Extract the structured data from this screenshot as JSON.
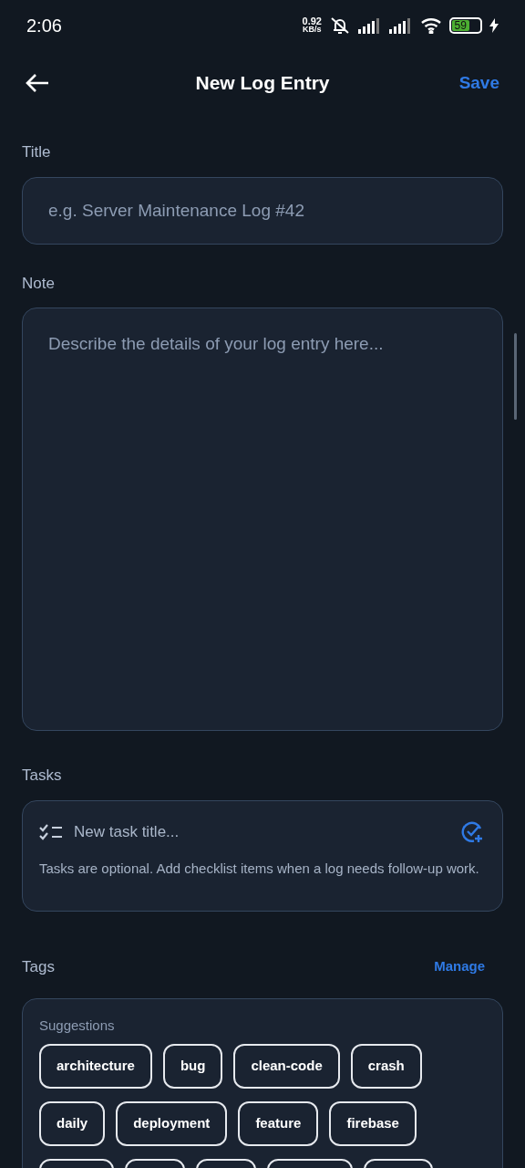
{
  "status_bar": {
    "time": "2:06",
    "speed_value": "0.92",
    "speed_unit": "KB/s",
    "battery": "59"
  },
  "header": {
    "title": "New Log Entry",
    "save": "Save"
  },
  "title_field": {
    "label": "Title",
    "placeholder": "e.g. Server Maintenance Log #42"
  },
  "note_field": {
    "label": "Note",
    "placeholder": "Describe the details of your log entry here..."
  },
  "tasks": {
    "label": "Tasks",
    "placeholder": "New task title...",
    "hint": "Tasks are optional. Add checklist items when a log needs follow-up work."
  },
  "tags": {
    "label": "Tags",
    "manage": "Manage",
    "suggestions_label": "Suggestions",
    "suggestions": [
      {
        "label": "architecture"
      },
      {
        "label": "bug"
      },
      {
        "label": "clean-code"
      },
      {
        "label": "crash"
      },
      {
        "label": "daily"
      },
      {
        "label": "deployment"
      },
      {
        "label": "feature"
      },
      {
        "label": "firebase"
      }
    ],
    "partial_suggestions": [
      {
        "kind": "chip"
      },
      {
        "kind": "chip"
      },
      {
        "kind": "chip"
      },
      {
        "kind": "chip"
      },
      {
        "kind": "chip"
      }
    ]
  }
}
